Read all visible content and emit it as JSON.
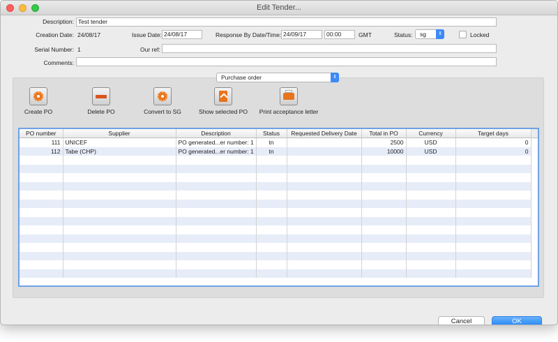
{
  "window": {
    "title": "Edit Tender..."
  },
  "form": {
    "description_label": "Description:",
    "description_value": "Test tender",
    "creation_date_label": "Creation Date:",
    "creation_date_value": "24/08/17",
    "issue_date_label": "Issue Date:",
    "issue_date_value": "24/08/17",
    "response_by_label": "Response By Date/Time:",
    "response_by_date": "24/09/17",
    "response_by_time": "00:00",
    "timezone": "GMT",
    "status_label": "Status:",
    "status_value": "sg",
    "locked_label": "Locked",
    "locked_checked": false,
    "serial_number_label": "Serial Number:",
    "serial_number_value": "1",
    "our_ref_label": "Our ref:",
    "our_ref_value": "",
    "comments_label": "Comments:",
    "comments_value": ""
  },
  "view_selector": {
    "value": "Purchase order"
  },
  "toolbar": {
    "create_po": "Create PO",
    "delete_po": "Delete PO",
    "convert_to_sg": "Convert to SG",
    "show_selected_po": "Show selected PO",
    "print_acceptance_letter": "Print acceptance letter"
  },
  "table": {
    "columns": [
      "PO number",
      "Supplier",
      "Description",
      "Status",
      "Requested Delivery Date",
      "Total in PO",
      "Currency",
      "Target days"
    ],
    "rows": [
      [
        "111",
        "UNICEF",
        "PO generated...er number: 1",
        "tn",
        "",
        "2500",
        "USD",
        "0"
      ],
      [
        "112",
        "Tabe (CHP)",
        "PO generated...er number: 1",
        "tn",
        "",
        "10000",
        "USD",
        "0"
      ]
    ]
  },
  "buttons": {
    "cancel": "Cancel",
    "ok": "OK"
  },
  "colors": {
    "accent": "#1d83f6",
    "stripe": "#e6ecf8",
    "icon_orange": "#e8741c"
  }
}
